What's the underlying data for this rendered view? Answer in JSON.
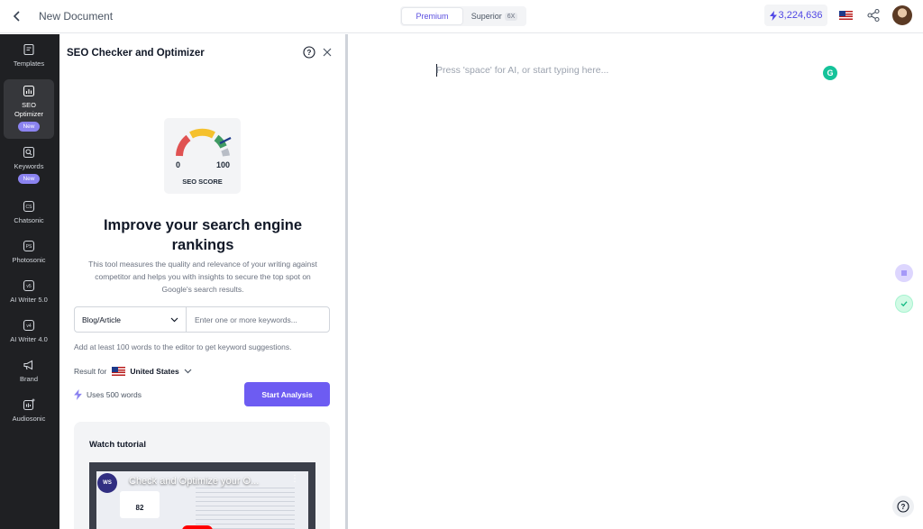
{
  "header": {
    "document_title": "New Document",
    "plans": [
      {
        "label": "Premium",
        "active": true
      },
      {
        "label": "Superior",
        "multiplier": "6X",
        "active": false
      }
    ],
    "credits": "3,224,636",
    "icons": [
      "back-icon",
      "lightning-icon",
      "us-flag-icon",
      "share-icon",
      "avatar"
    ]
  },
  "sidebar": {
    "items": [
      {
        "label": "Templates",
        "icon": "templates-icon"
      },
      {
        "label": "SEO Optimizer",
        "icon": "seo-chart-icon",
        "badge": "New",
        "active": true
      },
      {
        "label": "Keywords",
        "icon": "keywords-search-icon",
        "badge": "New"
      },
      {
        "label": "Chatsonic",
        "icon": "chatsonic-icon",
        "glyph": "CS"
      },
      {
        "label": "Photosonic",
        "icon": "photosonic-icon",
        "glyph": "PS"
      },
      {
        "label": "AI Writer 5.0",
        "icon": "ai-writer-5-icon",
        "glyph": "v5"
      },
      {
        "label": "AI Writer 4.0",
        "icon": "ai-writer-4-icon",
        "glyph": "v4"
      },
      {
        "label": "Brand",
        "icon": "megaphone-icon"
      },
      {
        "label": "Audiosonic",
        "icon": "audiosonic-icon"
      }
    ]
  },
  "seo_panel": {
    "title": "SEO Checker and Optimizer",
    "gauge": {
      "min_label": "0",
      "max_label": "100",
      "caption": "SEO SCORE"
    },
    "headline": "Improve your search engine rankings",
    "description": "This tool measures the quality and relevance of your writing against competitor and helps you with insights to secure the top spot on Google's search results.",
    "content_type": "Blog/Article",
    "keyword_placeholder": "Enter one or more keywords...",
    "hint": "Add at least 100 words to the editor to get keyword suggestions.",
    "result_for_label": "Result for",
    "country": "United States",
    "uses_label": "Uses 500 words",
    "start_button": "Start Analysis",
    "tutorial": {
      "title": "Watch tutorial",
      "video_title": "Check and Optimize your O...",
      "video_logo": "WS",
      "video_score": "82"
    }
  },
  "editor": {
    "placeholder": "Press 'space' for AI, or start typing here...",
    "grammarly_glyph": "G"
  },
  "colors": {
    "accent": "#6d5cf2",
    "sidebar_bg": "#1f2023",
    "gauge_red": "#e05252",
    "gauge_yellow": "#f5c12e",
    "gauge_green": "#3f9a63",
    "gauge_gray": "#b8bdc6"
  }
}
